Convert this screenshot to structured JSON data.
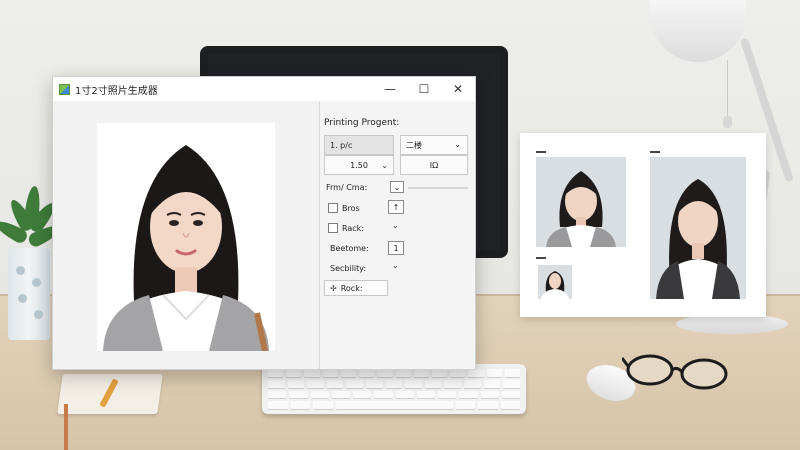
{
  "window": {
    "title": "1寸2寸照片生成器",
    "controls": {
      "minimize": "—",
      "maximize": "☐",
      "close": "✕"
    }
  },
  "panel": {
    "heading": "Printing Progent:",
    "size_select": {
      "value": "1. p/c",
      "sub_value": "1.50"
    },
    "layout_select": {
      "value": "二楼"
    },
    "format_value": "IΩ",
    "frame_label": "Frm/ Cma:",
    "options": [
      {
        "label": "Bros",
        "checked": false,
        "control": "↑"
      },
      {
        "label": "Rack:",
        "checked": false,
        "control": "⌄"
      }
    ],
    "spacing_label": "Beetome:",
    "spacing_value": "1",
    "sensitivity_label": "Secbility:",
    "action_button": "Rock:"
  },
  "icons": {
    "app": "app-icon",
    "dropdown": "chevron-down-icon",
    "move": "move-icon"
  },
  "colors": {
    "accent": "#3f8ad8",
    "photo_background": "#ffffff",
    "sheet_photo_background": "#d9dee3"
  }
}
